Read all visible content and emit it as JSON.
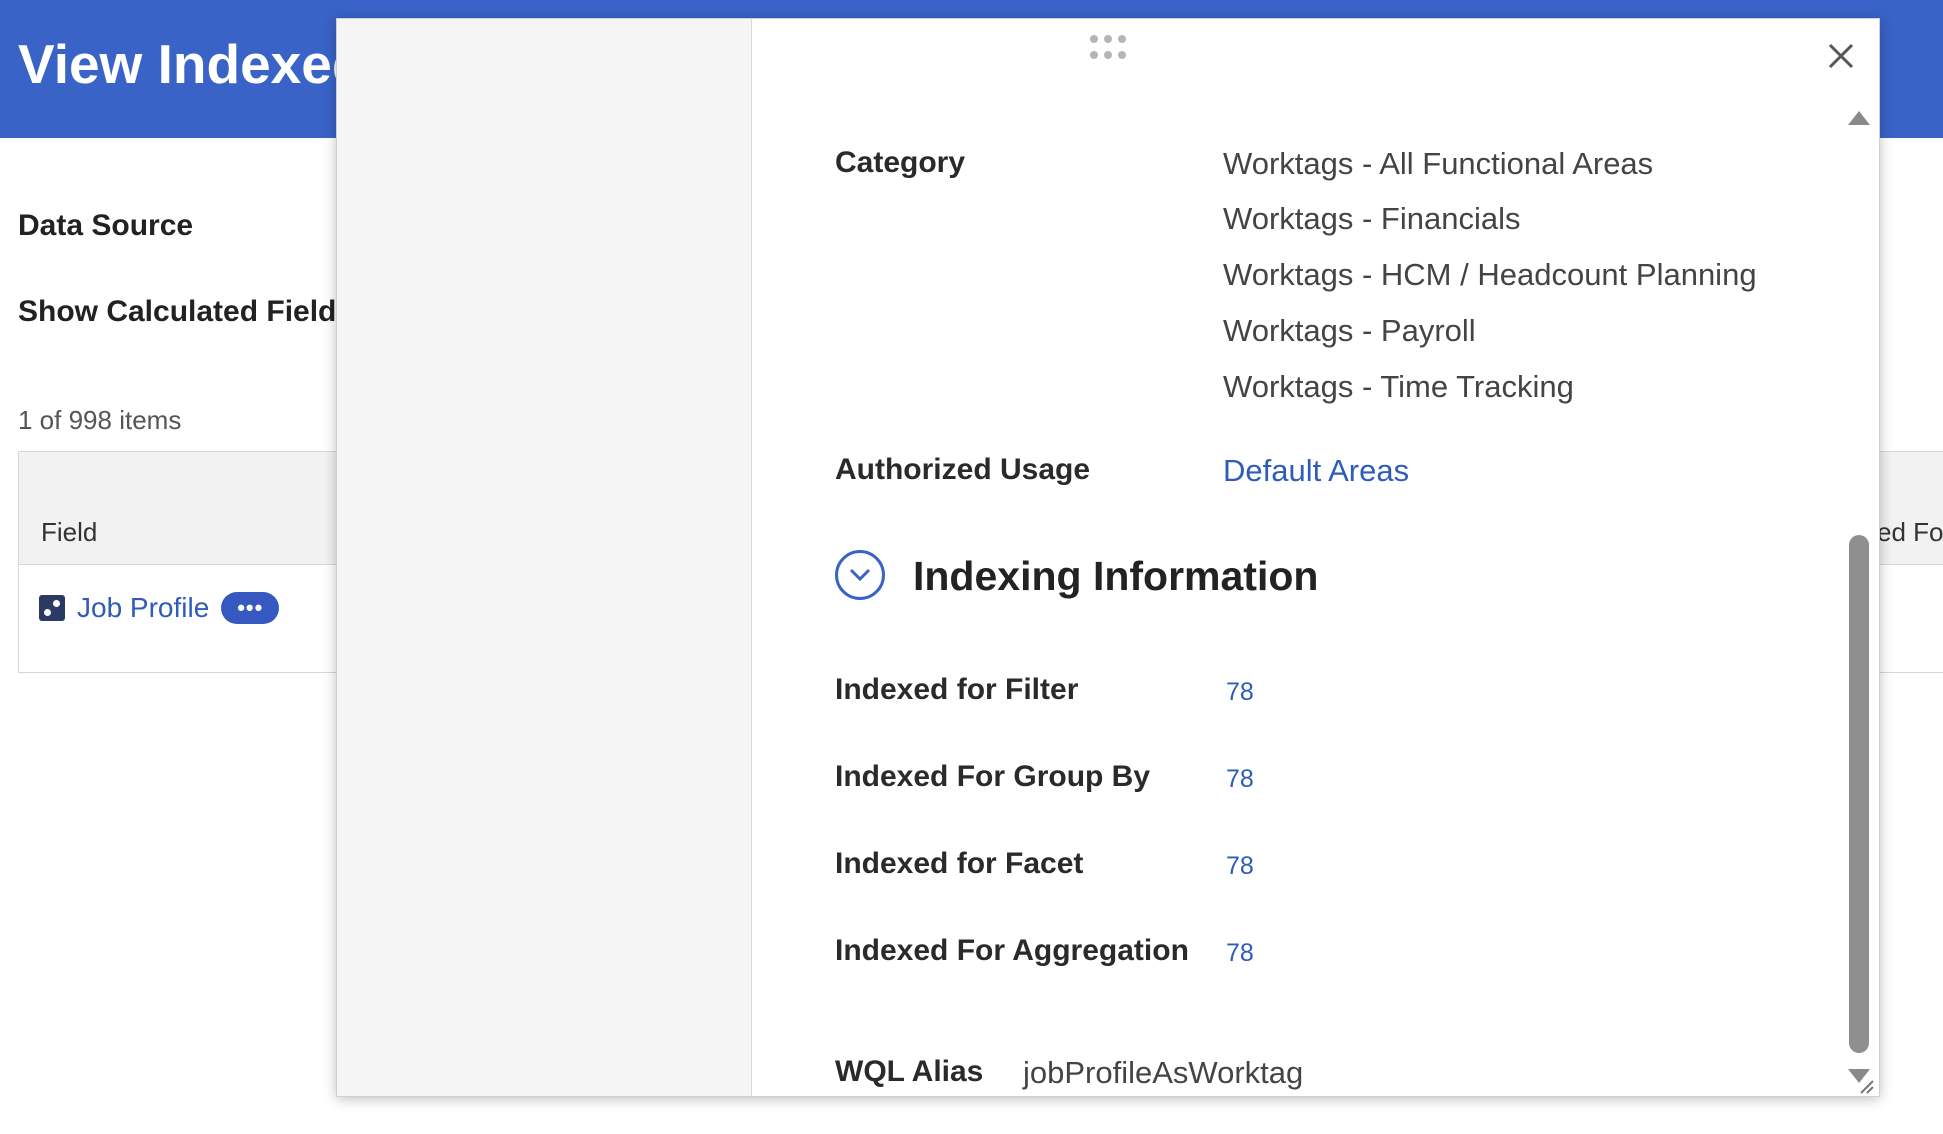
{
  "page": {
    "title": "View Indexed",
    "data_source_label": "Data Source",
    "show_calc_label": "Show Calculated Fields",
    "items_count": "1 of 998 items",
    "table": {
      "col_field": "Field",
      "col_right_partial": "ed Fo",
      "row_link": "Job Profile",
      "row_button": "•••"
    }
  },
  "modal": {
    "close_glyph": "✕",
    "category_label": "Category",
    "categories": [
      "Worktags - All Functional Areas",
      "Worktags - Financials",
      "Worktags - HCM / Headcount Planning",
      "Worktags - Payroll",
      "Worktags - Time Tracking"
    ],
    "authorized_usage_label": "Authorized Usage",
    "authorized_usage_value": "Default Areas",
    "section_title": "Indexing Information",
    "indexing": [
      {
        "label": "Indexed for Filter",
        "value": "78"
      },
      {
        "label": "Indexed For Group By",
        "value": "78"
      },
      {
        "label": "Indexed for Facet",
        "value": "78"
      },
      {
        "label": "Indexed For Aggregation",
        "value": "78"
      }
    ],
    "wql_label": "WQL Alias",
    "wql_value": "jobProfileAsWorktag"
  },
  "colors": {
    "header": "#3a63c7",
    "link": "#2e5cb8",
    "pill": "#3559c0"
  },
  "icons": {
    "close": "close-icon",
    "grip": "drag-handle-icon",
    "toggle": "chevron-down-icon",
    "object": "related-object-icon"
  }
}
